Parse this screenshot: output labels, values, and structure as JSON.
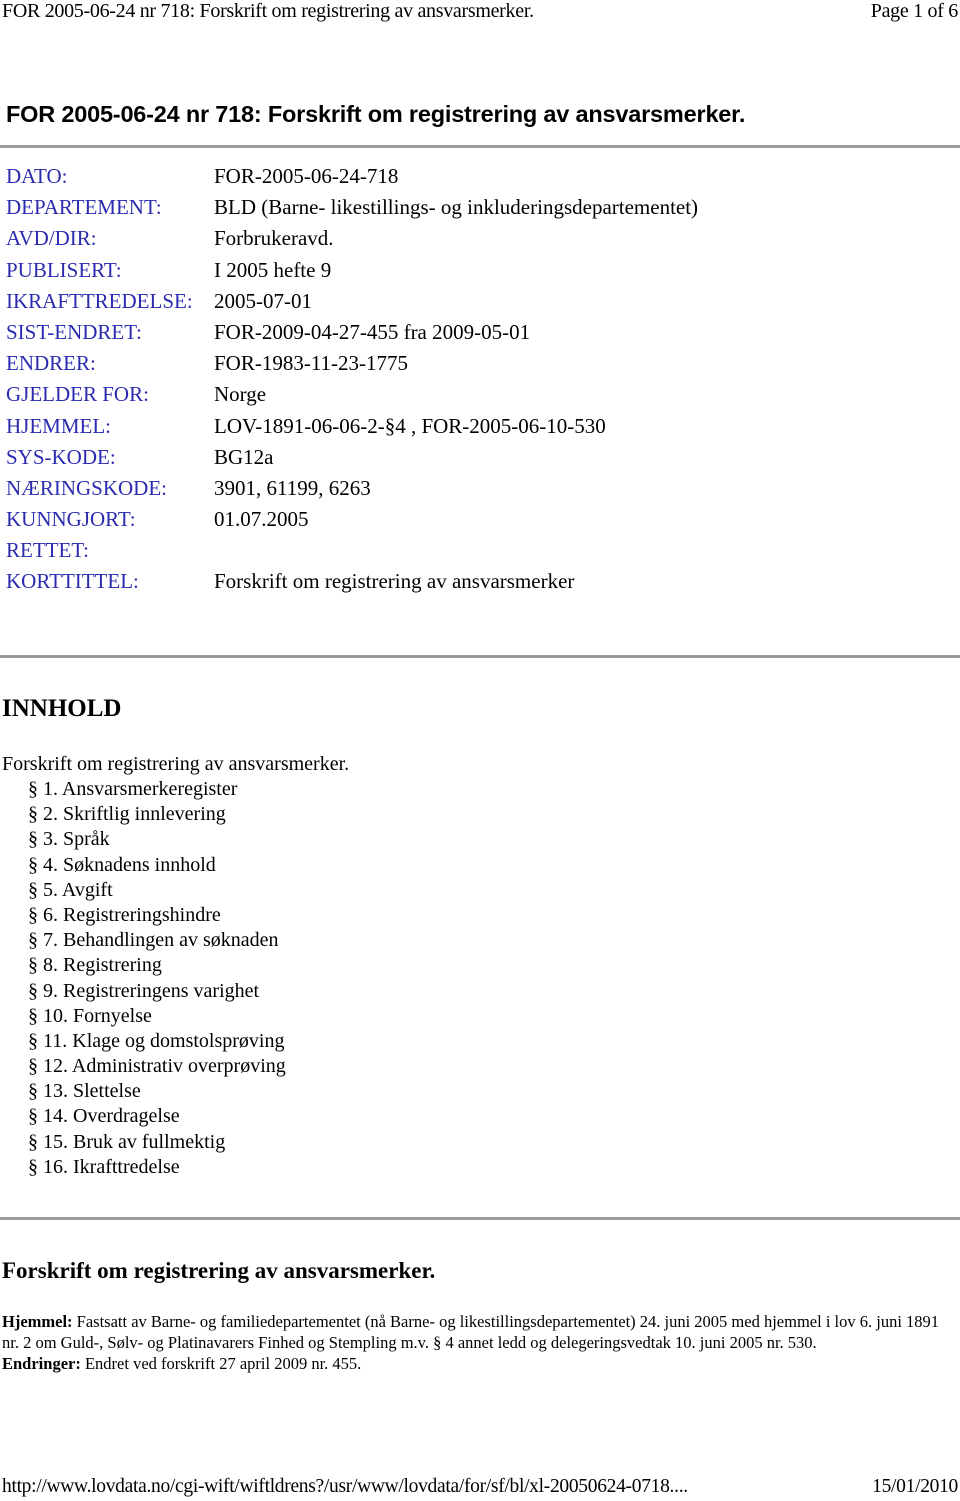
{
  "page_header": {
    "title": "FOR 2005-06-24 nr 718: Forskrift om registrering av ansvarsmerker.",
    "page_indicator": "Page 1 of 6"
  },
  "document_title": "FOR 2005-06-24 nr 718: Forskrift om registrering av ansvarsmerker.",
  "metadata": [
    {
      "label": "DATO:",
      "value": "FOR-2005-06-24-718"
    },
    {
      "label": "DEPARTEMENT:",
      "value": "BLD (Barne- likestillings- og inkluderingsdepartementet)"
    },
    {
      "label": "AVD/DIR:",
      "value": "Forbrukeravd."
    },
    {
      "label": "PUBLISERT:",
      "value": "I 2005 hefte 9"
    },
    {
      "label": "IKRAFTTREDELSE:",
      "value": "2005-07-01"
    },
    {
      "label": "SIST-ENDRET:",
      "value": "FOR-2009-04-27-455 fra 2009-05-01"
    },
    {
      "label": "ENDRER:",
      "value": "FOR-1983-11-23-1775"
    },
    {
      "label": "GJELDER FOR:",
      "value": "Norge"
    },
    {
      "label": "HJEMMEL:",
      "value": "LOV-1891-06-06-2-§4 , FOR-2005-06-10-530"
    },
    {
      "label": "SYS-KODE:",
      "value": "BG12a"
    },
    {
      "label": "NÆRINGSKODE:",
      "value": "3901, 61199, 6263"
    },
    {
      "label": "KUNNGJORT:",
      "value": "01.07.2005"
    },
    {
      "label": "RETTET:",
      "value": ""
    },
    {
      "label": "KORTTITTEL:",
      "value": "Forskrift om registrering av ansvarsmerker"
    }
  ],
  "contents": {
    "heading": "INNHOLD",
    "title": "Forskrift om registrering av ansvarsmerker.",
    "items": [
      {
        "symbol": "§",
        "label": "1. Ansvarsmerkeregister"
      },
      {
        "symbol": "§",
        "label": "2. Skriftlig innlevering"
      },
      {
        "symbol": "§",
        "label": "3. Språk"
      },
      {
        "symbol": "§",
        "label": "4. Søknadens innhold"
      },
      {
        "symbol": "§",
        "label": "5. Avgift"
      },
      {
        "symbol": "§",
        "label": "6. Registreringshindre"
      },
      {
        "symbol": "§",
        "label": "7. Behandlingen av søknaden"
      },
      {
        "symbol": "§",
        "label": "8. Registrering"
      },
      {
        "symbol": "§",
        "label": "9. Registreringens varighet"
      },
      {
        "symbol": "§",
        "label": "10. Fornyelse"
      },
      {
        "symbol": "§",
        "label": "11. Klage og domstolsprøving"
      },
      {
        "symbol": "§",
        "label": "12. Administrativ overprøving"
      },
      {
        "symbol": "§",
        "label": "13. Slettelse"
      },
      {
        "symbol": "§",
        "label": "14. Overdragelse"
      },
      {
        "symbol": "§",
        "label": "15. Bruk av fullmektig"
      },
      {
        "symbol": "§",
        "label": "16. Ikrafttredelse"
      }
    ]
  },
  "section": {
    "heading": "Forskrift om registrering av ansvarsmerker.",
    "hjemmel_label": "Hjemmel:",
    "hjemmel_text": " Fastsatt av Barne- og familiedepartementet (nå Barne- og likestillingsdepartementet) 24. juni 2005 med hjemmel i lov 6. juni 1891 nr. 2 om Guld-, Sølv- og Platinavarers Finhed og Stempling m.v. § 4 annet ledd og delegeringsvedtak 10. juni 2005 nr. 530.",
    "endringer_label": "Endringer:",
    "endringer_text": " Endret ved forskrift 27 april 2009 nr. 455."
  },
  "page_footer": {
    "url": "http://www.lovdata.no/cgi-wift/wiftldrens?/usr/www/lovdata/for/sf/bl/xl-20050624-0718....",
    "date": "15/01/2010"
  }
}
